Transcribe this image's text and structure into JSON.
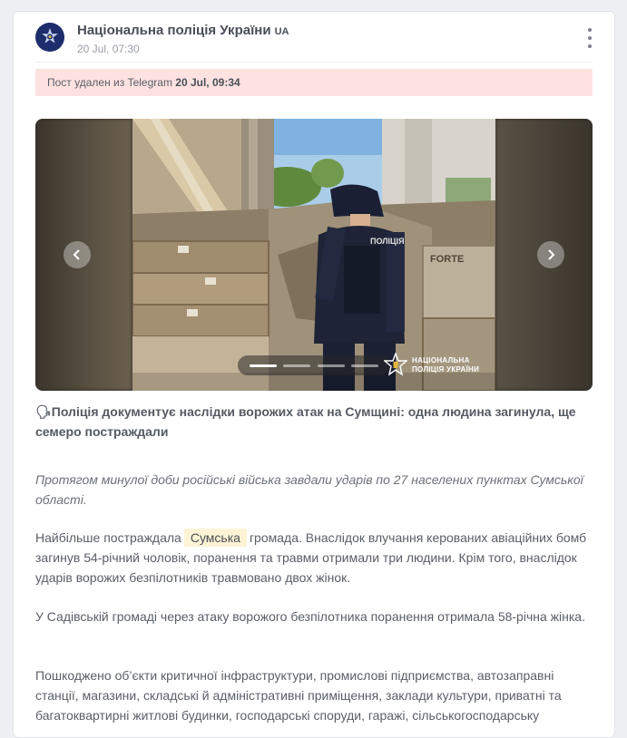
{
  "channel": {
    "name": "Національна поліція України",
    "badge": "UA",
    "date": "20 Jul, 07:30"
  },
  "deleted_notice": {
    "prefix": "Пост удален из Telegram",
    "time": "20 Jul, 09:34"
  },
  "gallery": {
    "prev_icon": "chevron-left-icon",
    "next_icon": "chevron-right-icon",
    "slides": 4,
    "active_slide": 1,
    "photo_labels": {
      "vest": "ПОЛІЦІЯ",
      "box": "FORTE"
    },
    "watermark_line1": "НАЦІОНАЛЬНА",
    "watermark_line2": "ПОЛІЦІЯ УКРАЇНИ"
  },
  "post": {
    "headline_icon": "🗣",
    "headline": "Поліція документує наслідки ворожих атак на Сумщині: одна людина загинула, ще семеро постраждали",
    "intro": "Протягом минулої доби російські війська завдали ударів по 27 населених пунктах Сумської області.",
    "p2_before": "Найбільше постраждала",
    "p2_highlight": "Сумська",
    "p2_after": "громада. Внаслідок влучання керованих авіаційних бомб загинув 54-річний чоловік, поранення та травми отримали три людини. Крім того, внаслідок ударів ворожих безпілотників травмовано двох жінок.",
    "p3": "У Садівській громаді через атаку ворожого безпілотника поранення отримала 58-річна жінка.",
    "p4": "Пошкоджено об’єкти критичної інфраструктури, промислові підприємства, автозаправні станції, магазини, складські й адміністративні приміщення, заклади культури, приватні та багатоквартирні житлові будинки, господарські споруди, гаражі, сільськогосподарську"
  },
  "colors": {
    "banner_bg": "#fde2e1",
    "highlight_bg": "#fdf3d5",
    "avatar_bg": "#1d2d6b"
  }
}
